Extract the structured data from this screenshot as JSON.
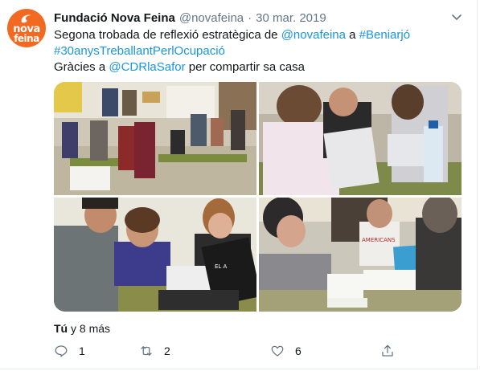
{
  "tweet": {
    "author_name": "Fundació Nova Feina",
    "handle": "@novafeina",
    "separator": "·",
    "date": "30 mar. 2019",
    "avatar_text_1": "nova",
    "avatar_text_2": "feina",
    "lines": [
      [
        {
          "t": "Segona trobada de reflexió estratègica de ",
          "link": false
        },
        {
          "t": "@novafeina",
          "link": true
        },
        {
          "t": " a ",
          "link": false
        },
        {
          "t": "#Beniarjó",
          "link": true
        }
      ],
      [
        {
          "t": "#30anysTreballantPerlOcupació",
          "link": true
        }
      ],
      [
        {
          "t": "Gràcies a ",
          "link": false
        },
        {
          "t": "@CDRlaSafor",
          "link": true
        },
        {
          "t": " per compartir sa casa",
          "link": false
        }
      ]
    ],
    "liked_by_bold": "Tú",
    "liked_by_rest": " y 8 más",
    "actions": {
      "reply_count": "1",
      "retweet_count": "2",
      "like_count": "6"
    }
  },
  "photos": [
    {
      "label": "classroom-group-photo",
      "caption": ""
    },
    {
      "label": "women-laptop-photo",
      "caption": ""
    },
    {
      "label": "three-people-laptop-photo",
      "caption": ""
    },
    {
      "label": "two-men-papers-photo",
      "caption": ""
    }
  ],
  "photo_texts": {
    "shirt_1": "EL A",
    "shirt_2": "AMERICANS"
  },
  "colors": {
    "brand_orange": "#f26a21",
    "link_blue": "#1b95e0",
    "muted_gray": "#657786",
    "text_dark": "#14171a"
  }
}
